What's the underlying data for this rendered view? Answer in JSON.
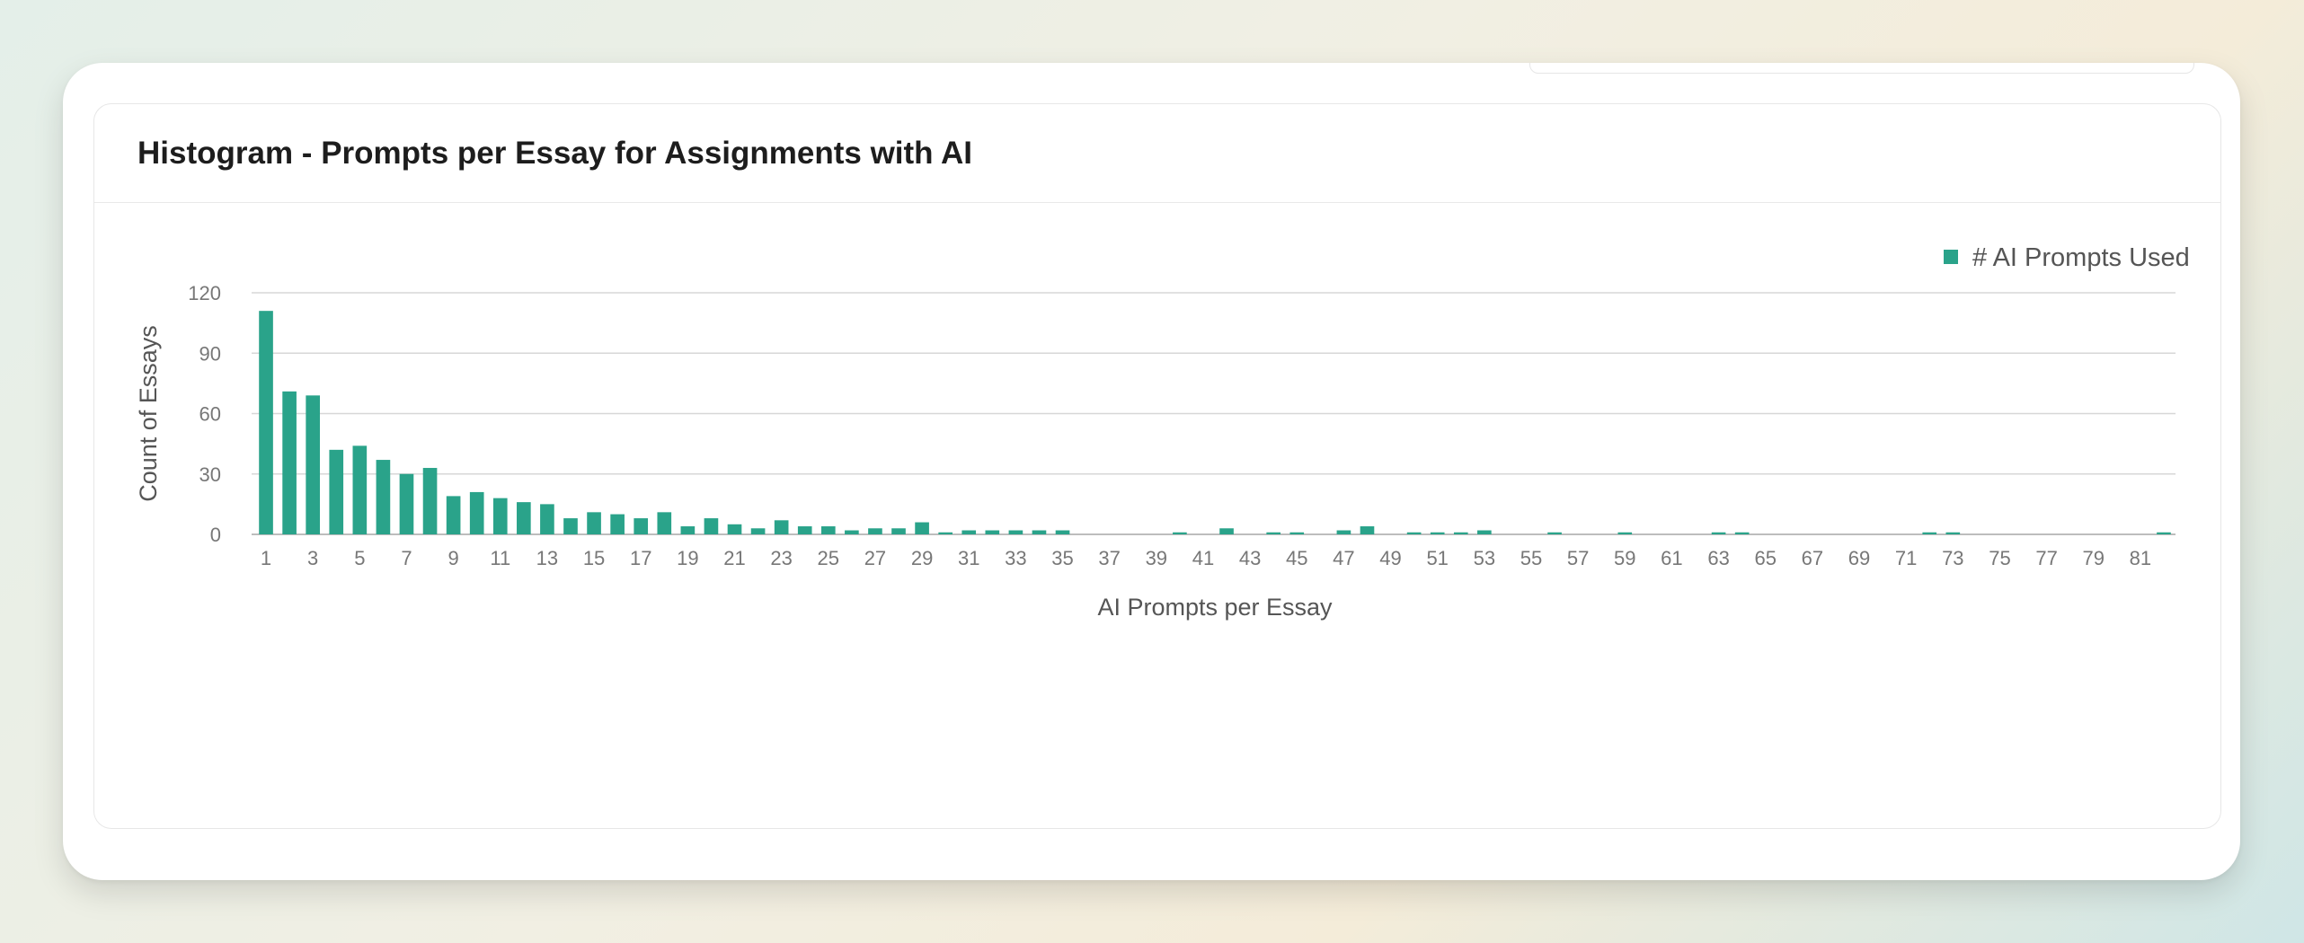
{
  "chart_data": {
    "type": "bar",
    "title": "Histogram - Prompts per Essay for Assignments with AI",
    "xlabel": "AI Prompts per Essay",
    "ylabel": "Count of Essays",
    "ylim": [
      0,
      120
    ],
    "yticks": [
      0,
      30,
      60,
      90,
      120
    ],
    "legend_position": "top-right",
    "grid": true,
    "bar_color": "#2aa38a",
    "x": [
      1,
      2,
      3,
      4,
      5,
      6,
      7,
      8,
      9,
      10,
      11,
      12,
      13,
      14,
      15,
      16,
      17,
      18,
      19,
      20,
      21,
      22,
      23,
      24,
      25,
      26,
      27,
      28,
      29,
      30,
      31,
      32,
      33,
      34,
      35,
      36,
      37,
      38,
      39,
      40,
      41,
      42,
      43,
      44,
      45,
      46,
      47,
      48,
      49,
      50,
      51,
      52,
      53,
      54,
      55,
      56,
      57,
      58,
      59,
      60,
      61,
      62,
      63,
      64,
      65,
      66,
      67,
      68,
      69,
      70,
      71,
      72,
      73,
      74,
      75,
      76,
      77,
      78,
      79,
      80,
      81,
      82
    ],
    "series": [
      {
        "name": "# AI Prompts Used",
        "values": [
          111,
          71,
          69,
          42,
          44,
          37,
          30,
          33,
          19,
          21,
          18,
          16,
          15,
          8,
          11,
          10,
          8,
          11,
          4,
          8,
          5,
          3,
          7,
          4,
          4,
          2,
          3,
          3,
          6,
          1,
          2,
          2,
          2,
          2,
          2,
          0,
          0,
          0,
          0,
          1,
          0,
          3,
          0,
          1,
          1,
          0,
          2,
          4,
          0,
          1,
          1,
          1,
          2,
          0,
          0,
          1,
          0,
          0,
          1,
          0,
          0,
          0,
          1,
          1,
          0,
          0,
          0,
          0,
          0,
          0,
          0,
          1,
          1,
          0,
          0,
          0,
          0,
          0,
          0,
          0,
          0,
          1
        ]
      }
    ]
  }
}
